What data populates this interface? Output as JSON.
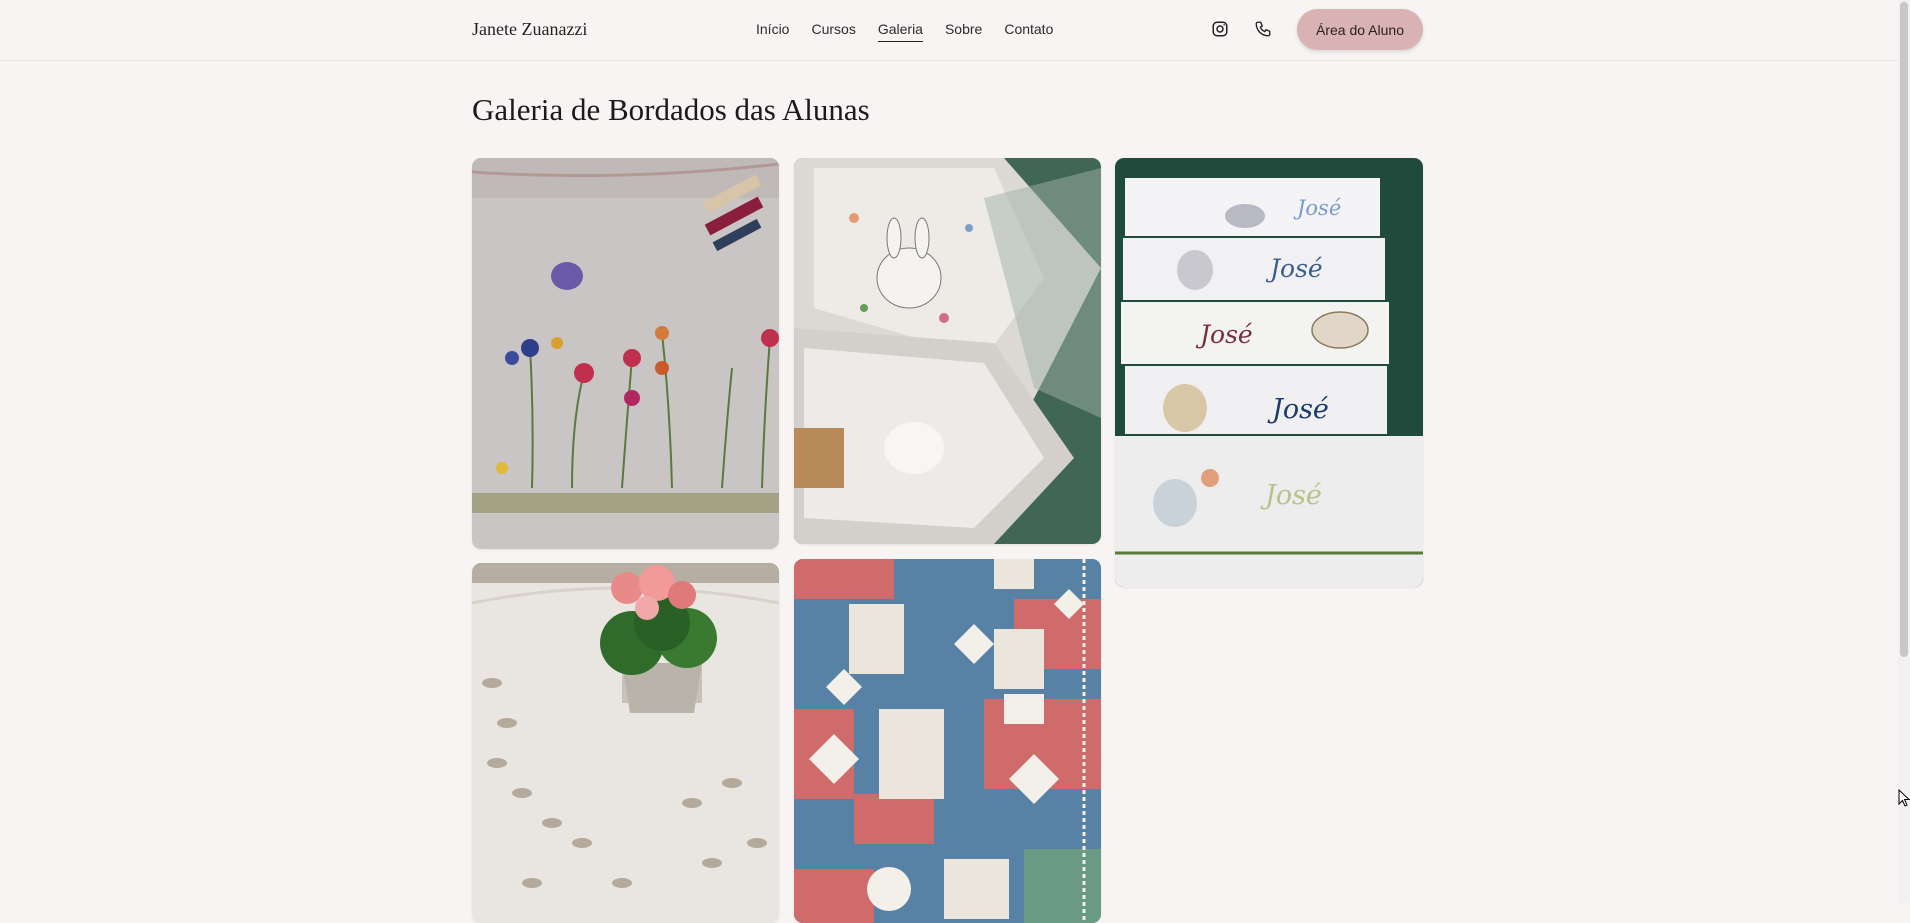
{
  "header": {
    "brand": "Janete Zuanazzi",
    "nav": [
      {
        "label": "Início",
        "active": false
      },
      {
        "label": "Cursos",
        "active": false
      },
      {
        "label": "Galeria",
        "active": true
      },
      {
        "label": "Sobre",
        "active": false
      },
      {
        "label": "Contato",
        "active": false
      }
    ],
    "icons": [
      "instagram-icon",
      "phone-icon"
    ],
    "cta_label": "Área do Aluno"
  },
  "main": {
    "title": "Galeria de Bordados das Alunas",
    "photos": [
      "flower-embroidery-photo",
      "bunny-embroidery-photo",
      "jose-towels-photo",
      "tablecloth-photo",
      "patchwork-quilt-photo"
    ],
    "towel_names": [
      "José",
      "José",
      "José",
      "José",
      "José"
    ]
  },
  "colors": {
    "background": "#f8f4f3",
    "accent": "#d9b3b3",
    "text": "#1d1d1d"
  }
}
